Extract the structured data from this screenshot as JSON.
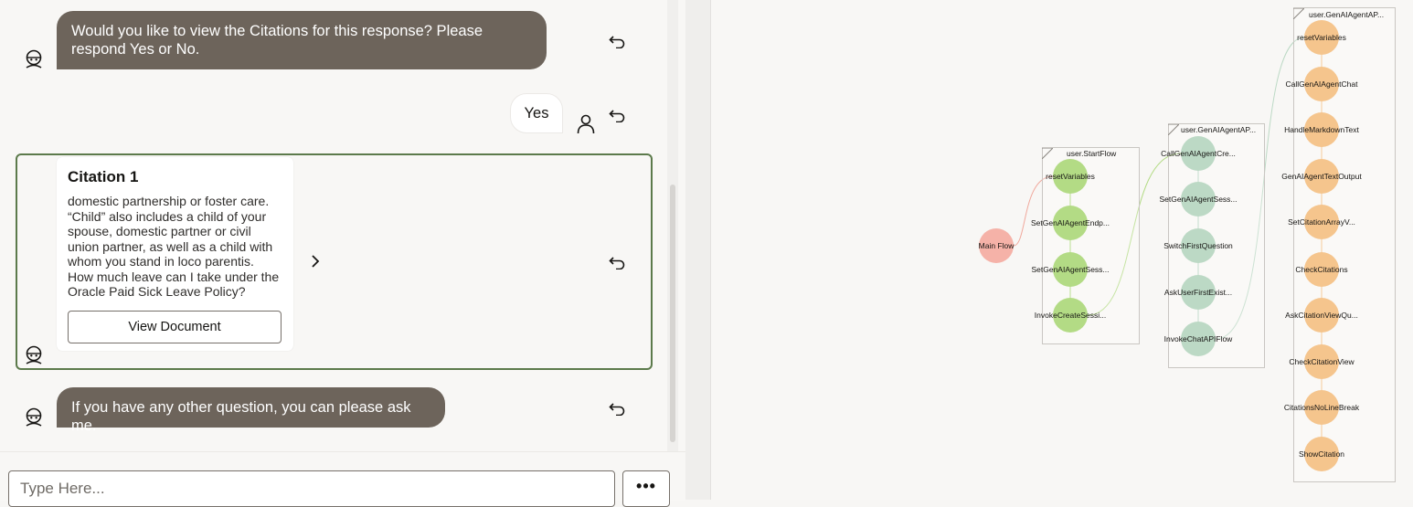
{
  "chat": {
    "messages": [
      {
        "role": "bot",
        "text": "Would you like to view the Citations for this response? Please respond Yes or No."
      },
      {
        "role": "user",
        "text": "Yes"
      },
      {
        "role": "bot",
        "text": "If you have any other question, you can please ask me."
      }
    ],
    "citation": {
      "title": "Citation 1",
      "body": "domestic partnership or foster care. “Child” also includes a child of your spouse, domestic partner or civil union  partner, as well as a child with whom you stand in loco parentis. How much leave can I take under the Oracle Paid Sick Leave Policy?",
      "button_label": "View Document"
    },
    "input": {
      "placeholder": "Type Here...",
      "value": ""
    },
    "more_label": "•••",
    "icons": {
      "bot": "bot-avatar-icon",
      "user": "user-avatar-icon",
      "reply": "reply-icon",
      "next": "chevron-right-icon"
    }
  },
  "flow": {
    "root": {
      "label": "Main Flow"
    },
    "groups": [
      {
        "title": "user.StartFlow",
        "color": "#b3db85",
        "nodes": [
          "resetVariables",
          "SetGenAIAgentEndp...",
          "SetGenAIAgentSess...",
          "InvokeCreateSessi..."
        ]
      },
      {
        "title": "user.GenAIAgentAP...",
        "color": "#bcd9c5",
        "nodes": [
          "CallGenAIAgentCre...",
          "SetGenAIAgentSess...",
          "SwitchFirstQuestion",
          "AskUserFirstExist...",
          "InvokeChatAPIFlow"
        ]
      },
      {
        "title": "user.GenAIAgentAP...",
        "color": "#f5c58d",
        "nodes": [
          "resetVariables",
          "CallGenAIAgentChat",
          "HandleMarkdownText",
          "GenAIAgentTextOutput",
          "SetCitationArrayV...",
          "CheckCitations",
          "AskCitationViewQu...",
          "CheckCitationView",
          "CitationsNoLineBreak",
          "ShowCitation"
        ]
      }
    ]
  }
}
